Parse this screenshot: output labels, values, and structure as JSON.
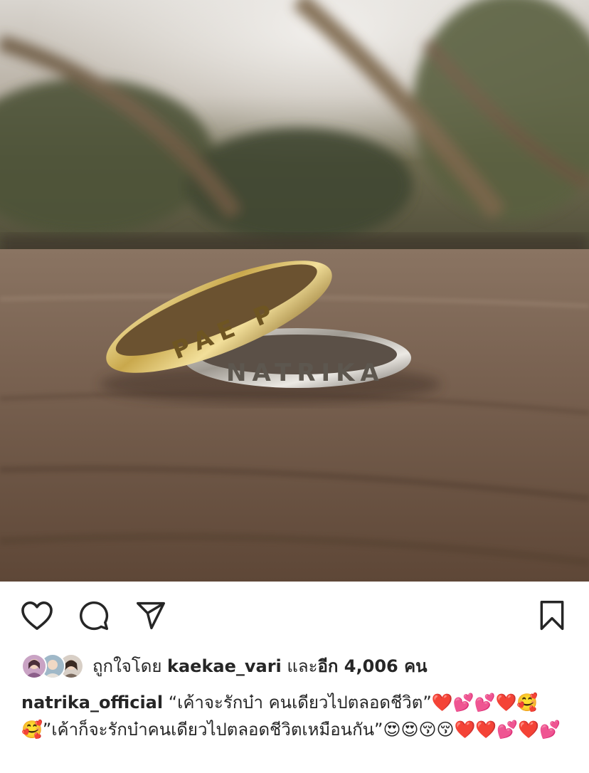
{
  "post": {
    "image_alt": "two engraved rings on wooden surface",
    "ring_engravings": [
      "PAE P",
      "NATRIKA"
    ]
  },
  "actions": {
    "like_icon": "heart-outline-icon",
    "comment_icon": "speech-bubble-icon",
    "share_icon": "paper-plane-icon",
    "save_icon": "bookmark-icon"
  },
  "likes": {
    "prefix": "ถูกใจโดย ",
    "user": "kaekae_vari",
    "middle": " และ",
    "count": "อีก 4,006 คน"
  },
  "caption": {
    "username": "natrika_official",
    "text": " “เค้าจะรักบ๋า คนเดียวไปตลอดชีวิต”❤️💕💕❤️🥰🥰”เค้าก็จะรักบ๋าคนเดียวไปตลอดชีวิตเหมือนกัน”😍😍😚😚❤️❤️💕❤️💕"
  }
}
